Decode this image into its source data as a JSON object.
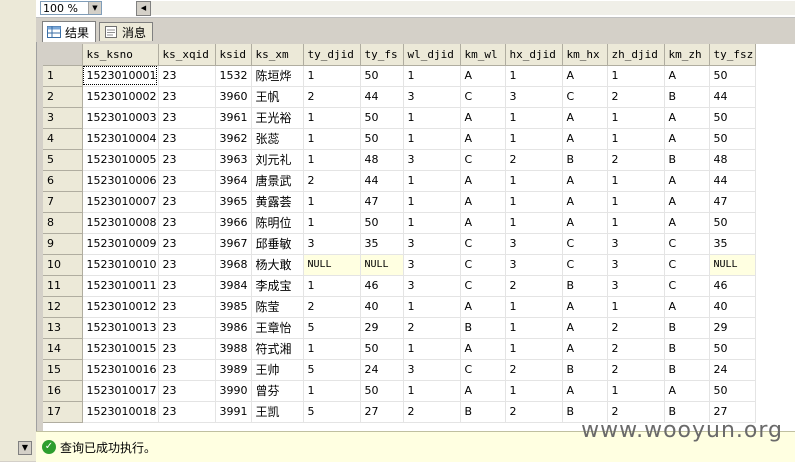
{
  "zoom": {
    "value": "100 %"
  },
  "tabs": [
    {
      "label": "结果",
      "icon": "grid-icon"
    },
    {
      "label": "消息",
      "icon": "message-icon"
    }
  ],
  "grid": {
    "columns": [
      "ks_ksno",
      "ks_xqid",
      "ksid",
      "ks_xm",
      "ty_djid",
      "ty_fs",
      "wl_djid",
      "km_wl",
      "hx_djid",
      "km_hx",
      "zh_djid",
      "km_zh",
      "ty_fsz"
    ],
    "rows": [
      [
        "1",
        "1523010001",
        "23",
        "1532",
        "陈垣烨",
        "1",
        "50",
        "1",
        "A",
        "1",
        "A",
        "1",
        "A",
        "50"
      ],
      [
        "2",
        "1523010002",
        "23",
        "3960",
        "王帆",
        "2",
        "44",
        "3",
        "C",
        "3",
        "C",
        "2",
        "B",
        "44"
      ],
      [
        "3",
        "1523010003",
        "23",
        "3961",
        "王光裕",
        "1",
        "50",
        "1",
        "A",
        "1",
        "A",
        "1",
        "A",
        "50"
      ],
      [
        "4",
        "1523010004",
        "23",
        "3962",
        "张蕊",
        "1",
        "50",
        "1",
        "A",
        "1",
        "A",
        "1",
        "A",
        "50"
      ],
      [
        "5",
        "1523010005",
        "23",
        "3963",
        "刘元礼",
        "1",
        "48",
        "3",
        "C",
        "2",
        "B",
        "2",
        "B",
        "48"
      ],
      [
        "6",
        "1523010006",
        "23",
        "3964",
        "唐景武",
        "2",
        "44",
        "1",
        "A",
        "1",
        "A",
        "1",
        "A",
        "44"
      ],
      [
        "7",
        "1523010007",
        "23",
        "3965",
        "黄露荟",
        "1",
        "47",
        "1",
        "A",
        "1",
        "A",
        "1",
        "A",
        "47"
      ],
      [
        "8",
        "1523010008",
        "23",
        "3966",
        "陈明位",
        "1",
        "50",
        "1",
        "A",
        "1",
        "A",
        "1",
        "A",
        "50"
      ],
      [
        "9",
        "1523010009",
        "23",
        "3967",
        "邱垂敏",
        "3",
        "35",
        "3",
        "C",
        "3",
        "C",
        "3",
        "C",
        "35"
      ],
      [
        "10",
        "1523010010",
        "23",
        "3968",
        "杨大敢",
        "NULL",
        "NULL",
        "3",
        "C",
        "3",
        "C",
        "3",
        "C",
        "NULL"
      ],
      [
        "11",
        "1523010011",
        "23",
        "3984",
        "李成宝",
        "1",
        "46",
        "3",
        "C",
        "2",
        "B",
        "3",
        "C",
        "46"
      ],
      [
        "12",
        "1523010012",
        "23",
        "3985",
        "陈莹",
        "2",
        "40",
        "1",
        "A",
        "1",
        "A",
        "1",
        "A",
        "40"
      ],
      [
        "13",
        "1523010013",
        "23",
        "3986",
        "王章怡",
        "5",
        "29",
        "2",
        "B",
        "1",
        "A",
        "2",
        "B",
        "29"
      ],
      [
        "14",
        "1523010015",
        "23",
        "3988",
        "符式湘",
        "1",
        "50",
        "1",
        "A",
        "1",
        "A",
        "2",
        "B",
        "50"
      ],
      [
        "15",
        "1523010016",
        "23",
        "3989",
        "王帅",
        "5",
        "24",
        "3",
        "C",
        "2",
        "B",
        "2",
        "B",
        "24"
      ],
      [
        "16",
        "1523010017",
        "23",
        "3990",
        "曾芬",
        "1",
        "50",
        "1",
        "A",
        "1",
        "A",
        "1",
        "A",
        "50"
      ],
      [
        "17",
        "1523010018",
        "23",
        "3991",
        "王凯",
        "5",
        "27",
        "2",
        "B",
        "2",
        "B",
        "2",
        "B",
        "27"
      ]
    ]
  },
  "status": {
    "message": "查询已成功执行。",
    "icon": "check-circle-icon",
    "color": "#2e9e2e"
  },
  "watermark": "www.wooyun.org"
}
